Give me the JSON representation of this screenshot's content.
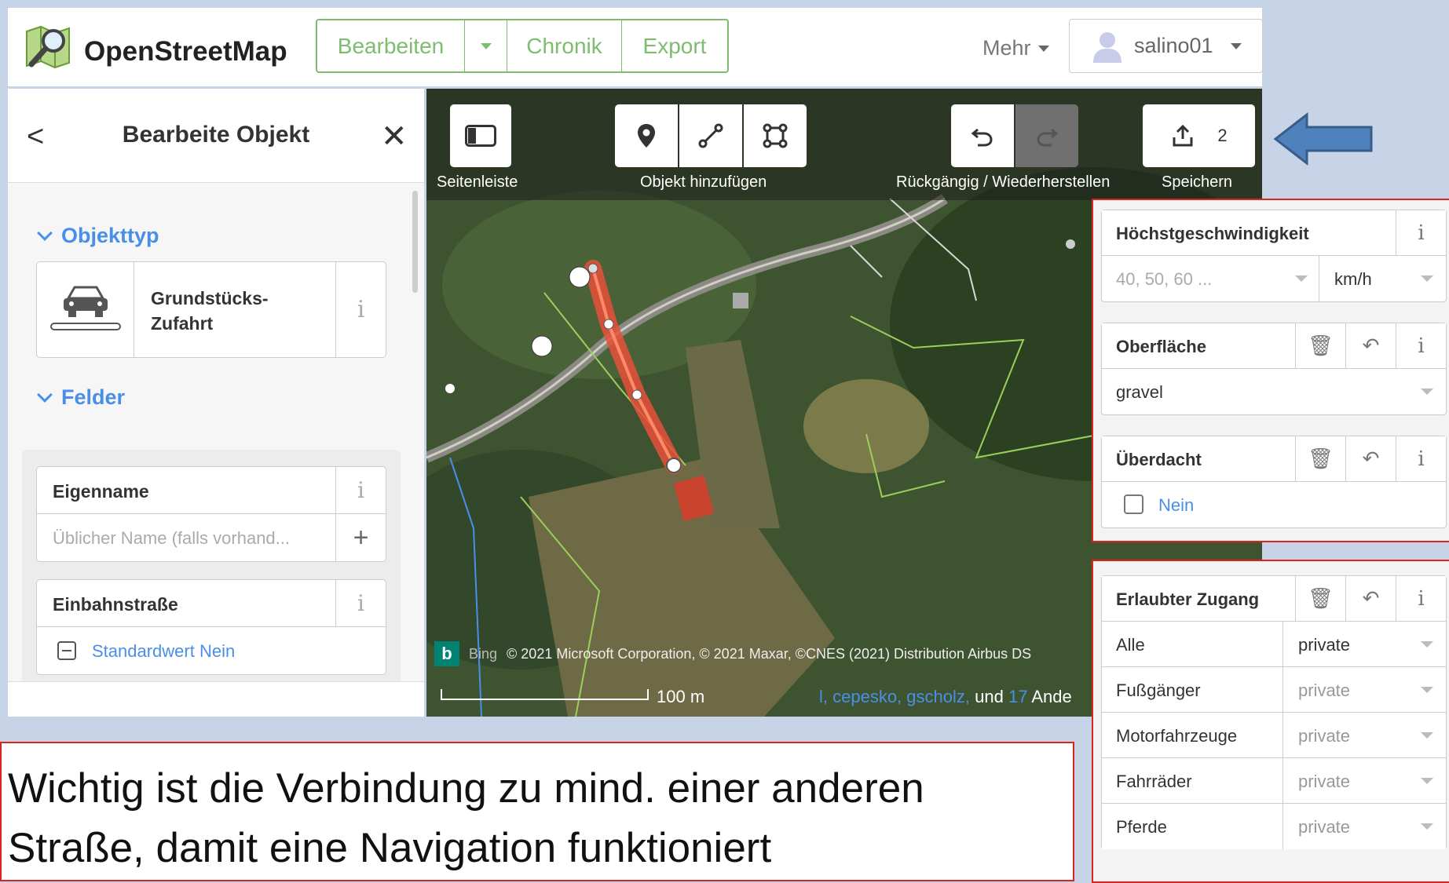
{
  "header": {
    "brand": "OpenStreetMap",
    "edit_label": "Bearbeiten",
    "history_label": "Chronik",
    "export_label": "Export",
    "more_label": "Mehr",
    "username": "salino01"
  },
  "sidebar": {
    "title": "Bearbeite Objekt",
    "section_type": "Objekttyp",
    "object_type_line1": "Grundstücks-",
    "object_type_line2": "Zufahrt",
    "section_fields": "Felder",
    "fields": {
      "name_label": "Eigenname",
      "name_placeholder": "Üblicher Name (falls vorhand...",
      "oneway_label": "Einbahnstraße",
      "oneway_value": "Standardwert Nein"
    }
  },
  "map": {
    "toolbar": {
      "sidebar_label": "Seitenleiste",
      "add_label": "Objekt hinzufügen",
      "undo_label": "Rückgängig / Wiederherstellen",
      "save_label": "Speichern",
      "save_count": "2"
    },
    "attribution_bing": "Bing",
    "attribution": "© 2021 Microsoft Corporation, © 2021 Maxar, ©CNES (2021) Distribution Airbus DS",
    "scale": "100 m",
    "contributors_prefix": "l, cepesko, gscholz,",
    "contributors_and": "und",
    "contributors_count": "17",
    "contributors_suffix": "Ande"
  },
  "right_panel_1": {
    "maxspeed_label": "Höchstgeschwindigkeit",
    "maxspeed_placeholder": "40, 50, 60 ...",
    "maxspeed_unit": "km/h",
    "surface_label": "Oberfläche",
    "surface_value": "gravel",
    "covered_label": "Überdacht",
    "covered_value": "Nein"
  },
  "right_panel_2": {
    "access_label": "Erlaubter Zugang",
    "rows": [
      {
        "label": "Alle",
        "value": "private"
      },
      {
        "label": "Fußgänger",
        "value": "private"
      },
      {
        "label": "Motorfahrzeuge",
        "value": "private"
      },
      {
        "label": "Fahrräder",
        "value": "private"
      },
      {
        "label": "Pferde",
        "value": "private"
      }
    ]
  },
  "caption": {
    "line1": "Wichtig ist die Verbindung zu mind. einer anderen",
    "line2": "Straße, damit eine Navigation funktioniert"
  },
  "colors": {
    "osm_green": "#7ebc6f",
    "link_blue": "#4a8fe7",
    "highlight_red": "#d9261c",
    "arrow_blue": "#4f81bd",
    "selected_way": "#e8503a"
  }
}
